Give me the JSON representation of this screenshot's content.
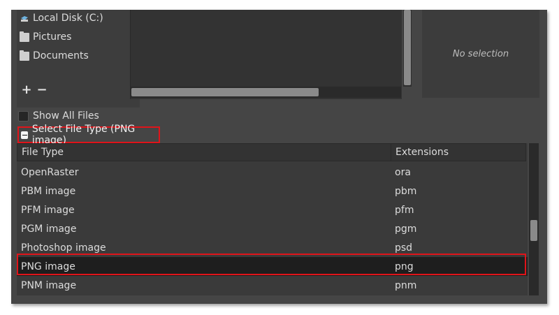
{
  "places": {
    "items": [
      {
        "label": "Local Disk (C:)",
        "icon": "drive-icon"
      },
      {
        "label": "Pictures",
        "icon": "folder-icon"
      },
      {
        "label": "Documents",
        "icon": "folder-icon"
      }
    ],
    "add_symbol": "+",
    "remove_symbol": "−"
  },
  "preview": {
    "text": "No selection"
  },
  "show_all_files": {
    "label": "Show All Files",
    "checked": false
  },
  "select_file_type": {
    "label": "Select File Type (PNG image)",
    "expanded": true
  },
  "file_types": {
    "columns": [
      "File Type",
      "Extensions"
    ],
    "rows": [
      {
        "type": "OpenRaster",
        "ext": "ora"
      },
      {
        "type": "PBM image",
        "ext": "pbm"
      },
      {
        "type": "PFM image",
        "ext": "pfm"
      },
      {
        "type": "PGM image",
        "ext": "pgm"
      },
      {
        "type": "Photoshop image",
        "ext": "psd"
      },
      {
        "type": "PNG image",
        "ext": "png"
      },
      {
        "type": "PNM image",
        "ext": "pnm"
      }
    ],
    "selected": "PNG image"
  },
  "colors": {
    "window_bg": "#454545",
    "highlight": "#e0141a",
    "selected_row": "#1e1e1e"
  }
}
